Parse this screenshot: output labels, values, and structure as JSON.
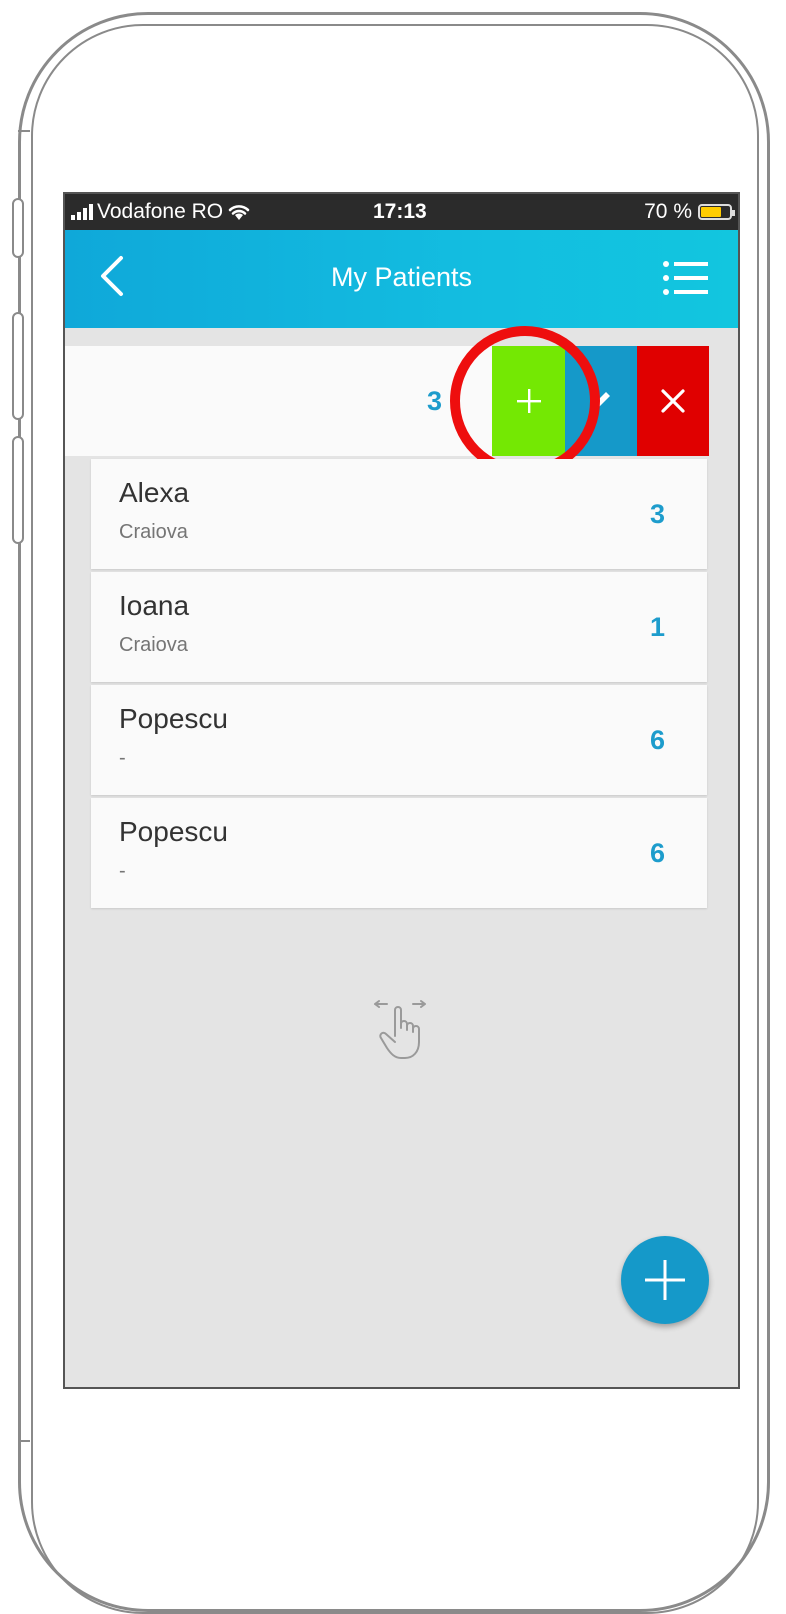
{
  "status_bar": {
    "carrier": "Vodafone RO",
    "time": "17:13",
    "battery": "70 %"
  },
  "app_bar": {
    "title": "My Patients",
    "back_icon": "chevron-left-icon",
    "menu_icon": "list-menu-icon"
  },
  "swiped_row": {
    "count": "3",
    "actions": [
      {
        "name": "add",
        "icon": "plus-icon",
        "color": "#74e803"
      },
      {
        "name": "edit",
        "icon": "pencil-icon",
        "color": "#1599c9"
      },
      {
        "name": "delete",
        "icon": "close-icon",
        "color": "#e00000"
      }
    ]
  },
  "patients": [
    {
      "name": "Alexa",
      "city": "Craiova",
      "count": "3"
    },
    {
      "name": "Ioana",
      "city": "Craiova",
      "count": "1"
    },
    {
      "name": "Popescu",
      "city": "-",
      "count": "6"
    },
    {
      "name": "Popescu",
      "city": "-",
      "count": "6"
    }
  ],
  "swipe_hint_icon": "swipe-hand-icon",
  "fab_icon": "plus-icon",
  "colors": {
    "accent": "#1599c9",
    "appbar": "#13bde0",
    "add": "#74e803",
    "delete": "#e00000",
    "highlight": "#ee0e0e",
    "background": "#e4e4e4"
  }
}
